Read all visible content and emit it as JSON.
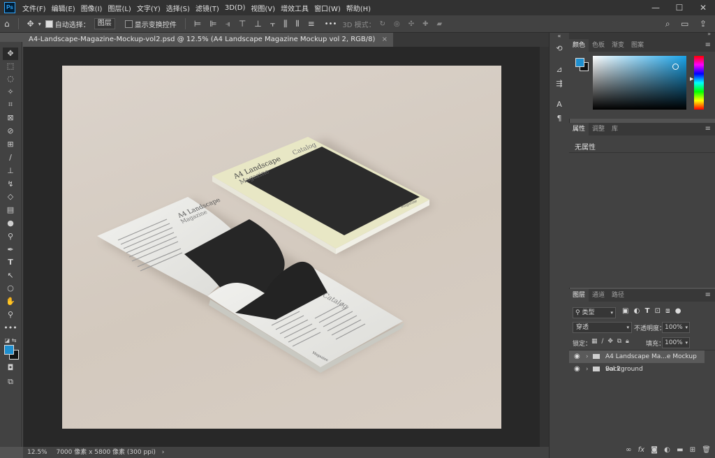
{
  "app": {
    "logo": "Ps"
  },
  "menu": [
    "文件(F)",
    "编辑(E)",
    "图像(I)",
    "图层(L)",
    "文字(Y)",
    "选择(S)",
    "滤镜(T)",
    "3D(D)",
    "视图(V)",
    "增效工具",
    "窗口(W)",
    "帮助(H)"
  ],
  "window_controls": {
    "minimize": "—",
    "maximize": "☐",
    "close": "✕"
  },
  "options_bar": {
    "auto_select_label": "自动选择：",
    "auto_select_target": "图层",
    "show_transform_label": "显示变换控件",
    "more": "•••",
    "mode_3d_label": "3D 模式："
  },
  "document_tab": {
    "title": "A4-Landscape-Magazine-Mockup-vol2.psd @ 12.5% (A4 Landscape Magazine Mockup vol 2, RGB/8)",
    "close": "×"
  },
  "status": {
    "zoom": "12.5%",
    "doc_size": "7000 像素 x 5800 像素 (300 ppi)",
    "arrow": "›"
  },
  "mockup": {
    "closed_title": "A4 Landscape",
    "closed_subtitle": "Magazine",
    "closed_catalog": "Catalog",
    "closed_brand": "Magazine",
    "open_title": "A4 Landscape",
    "open_subtitle": "Magazine",
    "open_catalog": "Catalog",
    "open_brand": "Magazine"
  },
  "color_panel": {
    "tabs": [
      "颜色",
      "色板",
      "渐变",
      "图案"
    ],
    "active": 0,
    "foreground": "#1e8fcf",
    "hue_base": "#1aa3e8"
  },
  "properties_panel": {
    "tabs": [
      "属性",
      "调整",
      "库"
    ],
    "active": 0,
    "empty_text": "无属性"
  },
  "layers_panel": {
    "tabs": [
      "图层",
      "通道",
      "路径"
    ],
    "active": 0,
    "filter_label": "类型",
    "blend_mode": "穿透",
    "opacity_label": "不透明度：",
    "opacity_value": "100%",
    "lock_label": "锁定：",
    "fill_label": "填充：",
    "fill_value": "100%",
    "layers": [
      {
        "name": "A4 Landscape Ma...e Mockup vol 2",
        "selected": true
      },
      {
        "name": "Background",
        "selected": false
      }
    ]
  }
}
